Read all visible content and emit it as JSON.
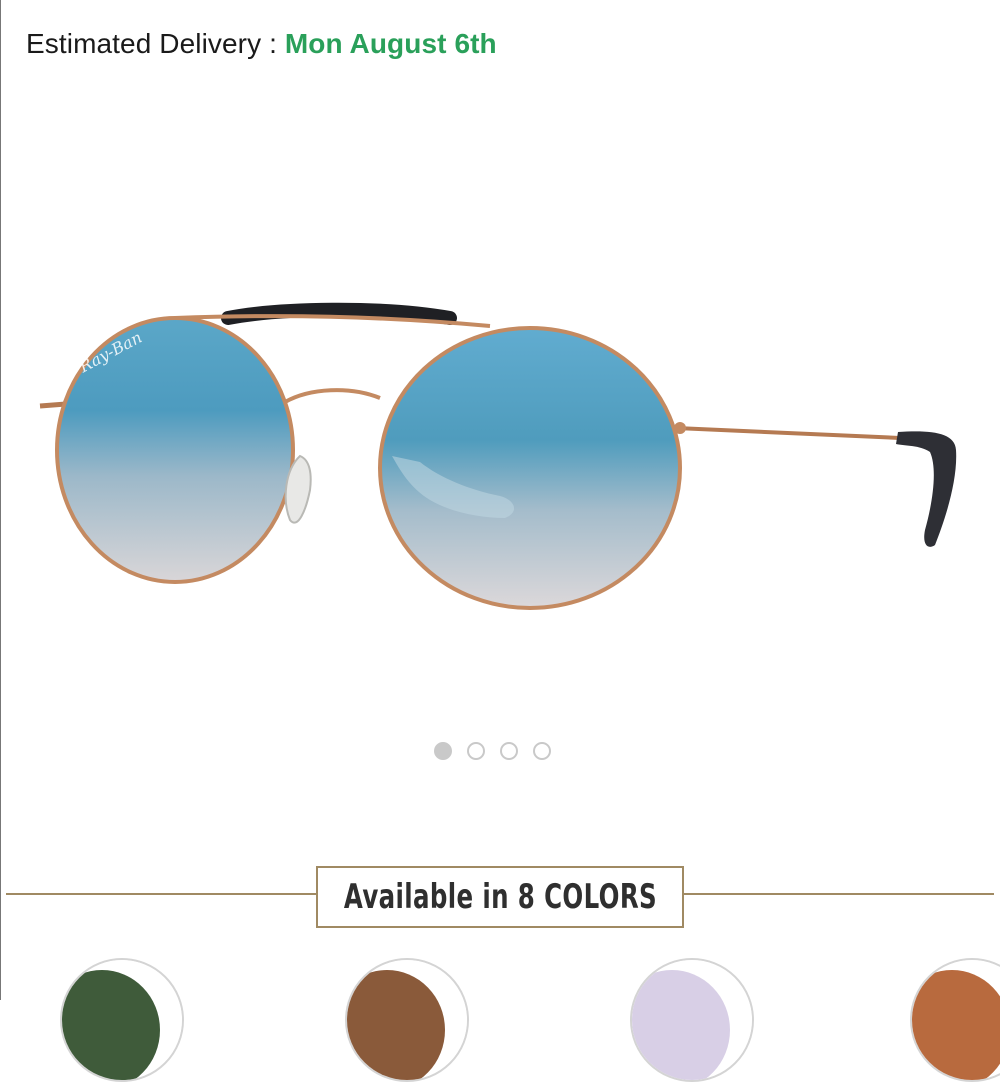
{
  "delivery": {
    "label": "Estimated Delivery : ",
    "date": "Mon August 6th",
    "date_color": "#2aa05a"
  },
  "product": {
    "image_icon": "sunglasses-image",
    "brand_mark": "Ray-Ban"
  },
  "carousel": {
    "total": 4,
    "active_index": 0
  },
  "colors": {
    "label": "Available in 8 COLORS",
    "border_color": "#a08a63",
    "swatches": [
      {
        "name": "green-lens-swatch",
        "color": "#3f5b3a"
      },
      {
        "name": "brown-lens-swatch",
        "color": "#8a5a3a"
      },
      {
        "name": "lilac-lens-swatch",
        "color": "#d8cfe6"
      },
      {
        "name": "copper-lens-swatch",
        "color": "#b86a3e"
      }
    ]
  }
}
